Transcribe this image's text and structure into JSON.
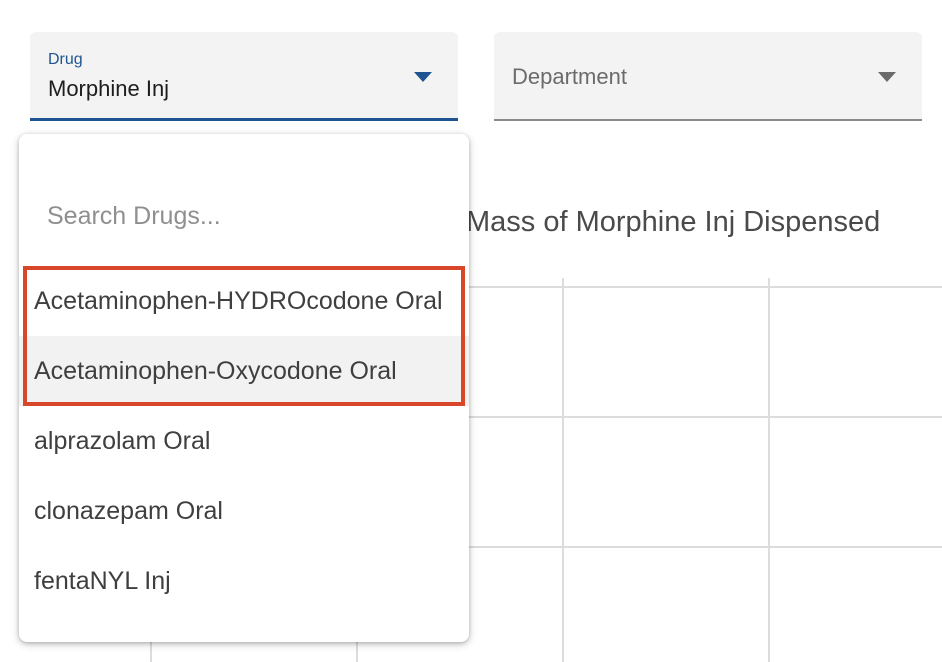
{
  "filters": {
    "drug": {
      "label": "Drug",
      "value": "Morphine Inj"
    },
    "department": {
      "placeholder": "Department"
    }
  },
  "chart": {
    "title": "Mass of Morphine Inj Dispensed"
  },
  "dropdown": {
    "search_placeholder": "Search Drugs...",
    "options": [
      "Acetaminophen-HYDROcodone Oral",
      "Acetaminophen-Oxycodone Oral",
      "alprazolam Oral",
      "clonazepam Oral",
      "fentaNYL Inj"
    ]
  },
  "colors": {
    "accent": "#1e5591",
    "highlight": "#d9472b",
    "field_bg": "#f3f3f3"
  },
  "icons": {
    "drug_dropdown": "caret-down-icon",
    "department_dropdown": "caret-down-icon"
  }
}
